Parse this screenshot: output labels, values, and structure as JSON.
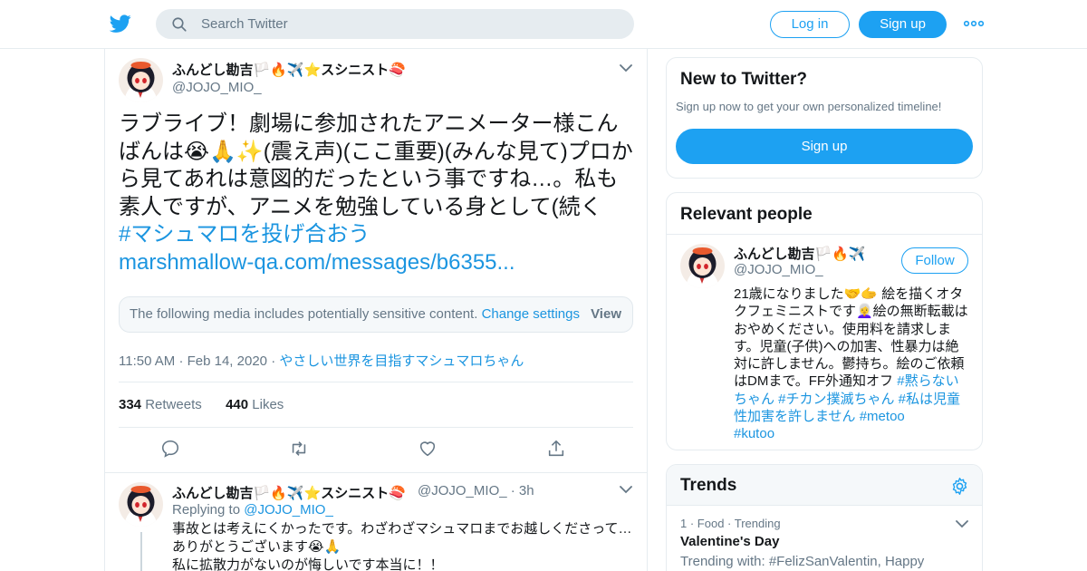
{
  "header": {
    "search_placeholder": "Search Twitter",
    "login_label": "Log in",
    "signup_label": "Sign up"
  },
  "tweet": {
    "author_name": "ふんどし勘吉🏳️🔥✈️⭐スシニスト🍣",
    "author_handle": "@JOJO_MIO_",
    "text": "ラブライブ！劇場に参加されたアニメーター様こんばんは😭🙏✨(震え声)(ここ重要)(みんな見て)プロから見てあれは意図的だったという事ですね…。私も素人ですが、アニメを勉強している身として(続く",
    "hashtag": "#マシュマロを投げ合おう",
    "url": "marshmallow-qa.com/messages/b6355...",
    "sensitive_notice": "The following media includes potentially sensitive content.",
    "change_settings": "Change settings",
    "view_label": "View",
    "time": "11:50 AM",
    "date": "Feb 14, 2020",
    "source": "やさしい世界を目指すマシュマロちゃん",
    "retweets": "334",
    "retweets_label": "Retweets",
    "likes": "440",
    "likes_label": "Likes"
  },
  "reply": {
    "author_name": "ふんどし勘吉🏳️🔥✈️⭐スシニスト🍣",
    "author_handle": "@JOJO_MIO_",
    "age": "3h",
    "replying_label": "Replying to",
    "replying_handle": "@JOJO_MIO_",
    "line1": "事故とは考えにくかったです。わざわざマシュマロまでお越しくださって…",
    "line2": "ありがとうございます😭🙏",
    "line3": "私に拡散力がないのが悔しいです本当に！！"
  },
  "new_to_twitter": {
    "title": "New to Twitter?",
    "subtitle": "Sign up now to get your own personalized timeline!",
    "signup_label": "Sign up"
  },
  "relevant": {
    "title": "Relevant people",
    "name": "ふんどし勘吉🏳️🔥✈️",
    "handle": "@JOJO_MIO_",
    "follow_label": "Follow",
    "bio_text": "21歳になりました🤝🫱 絵を描くオタクフェミニストです👩‍🦳絵の無断転載はおやめください。使用料を請求します。児童(子供)への加害、性暴力は絶対に許しません。鬱持ち。絵のご依頼はDMまで。FF外通知オフ ",
    "bio_tags": "#黙らないちゃん #チカン撲滅ちゃん #私は児童性加害を許しません #metoo",
    "bio_tail": "#kutoo"
  },
  "trends": {
    "title": "Trends",
    "item_rank": "1",
    "item_category": "Food · Trending",
    "item_name": "Valentine's Day",
    "item_with": "Trending with: #FelizSanValentin, Happy"
  },
  "colors": {
    "accent": "#1da1f2",
    "link": "#1b95e0",
    "muted": "#657786",
    "border": "#e6ecf0"
  }
}
